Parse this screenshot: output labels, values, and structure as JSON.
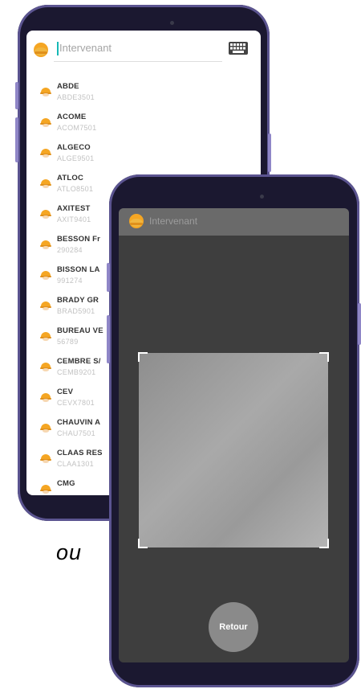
{
  "separator_text": "ou",
  "list_screen": {
    "search": {
      "placeholder": "Intervenant"
    },
    "icons": {
      "header": "helmet-icon",
      "keyboard": "keyboard-icon",
      "row": "helmet-icon"
    },
    "items": [
      {
        "name": "ABDE",
        "code": "ABDE3501"
      },
      {
        "name": "ACOME",
        "code": "ACOM7501"
      },
      {
        "name": "ALGECO",
        "code": "ALGE9501"
      },
      {
        "name": "ATLOC",
        "code": "ATLO8501"
      },
      {
        "name": "AXITEST",
        "code": "AXIT9401"
      },
      {
        "name": "BESSON Fr",
        "code": "290284"
      },
      {
        "name": "BISSON LA",
        "code": "991274"
      },
      {
        "name": "BRADY GR",
        "code": "BRAD5901"
      },
      {
        "name": "BUREAU VE",
        "code": "56789"
      },
      {
        "name": "CEMBRE S/",
        "code": "CEMB9201"
      },
      {
        "name": "CEV",
        "code": "CEVX7801"
      },
      {
        "name": "CHAUVIN A",
        "code": "CHAU7501"
      },
      {
        "name": "CLAAS RES",
        "code": "CLAA1301"
      },
      {
        "name": "CMG",
        "code": ""
      }
    ]
  },
  "scan_screen": {
    "title": "Intervenant",
    "back_label": "Retour"
  },
  "colors": {
    "helmet": "#f5a623",
    "cursor": "#16b8b5",
    "phone_frame": "#1b1830"
  }
}
